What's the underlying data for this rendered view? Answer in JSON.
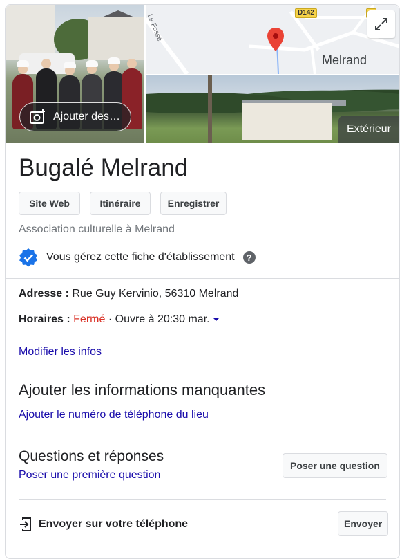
{
  "photos": {
    "add_photo_label": "Ajouter des…",
    "exterior_label": "Extérieur"
  },
  "map": {
    "city_label": "Melrand",
    "road_label_1": "D142",
    "road_label_2": "D",
    "street_label": "Le Fossé"
  },
  "place": {
    "name": "Bugalé Melrand",
    "category": "Association culturelle à Melrand"
  },
  "actions": {
    "website": "Site Web",
    "directions": "Itinéraire",
    "save": "Enregistrer"
  },
  "ownership": {
    "text": "Vous gérez cette fiche d'établissement",
    "help": "?"
  },
  "address": {
    "label": "Adresse :",
    "value": "Rue Guy Kervinio, 56310 Melrand"
  },
  "hours": {
    "label": "Horaires :",
    "status": "Fermé",
    "next": "· Ouvre à 20:30 mar."
  },
  "edit_link": "Modifier les infos",
  "missing": {
    "heading": "Ajouter les informations manquantes",
    "phone_link": "Ajouter le numéro de téléphone du lieu"
  },
  "qa": {
    "heading": "Questions et réponses",
    "first_question_link": "Poser une première question",
    "ask_button": "Poser une question"
  },
  "send": {
    "label": "Envoyer sur votre téléphone",
    "button": "Envoyer"
  },
  "colors": {
    "link": "#1a0dab",
    "closed": "#d93025",
    "verified_badge": "#1a73e8",
    "map_pin": "#ea4335"
  }
}
